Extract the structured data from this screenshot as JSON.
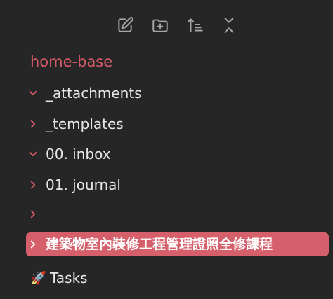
{
  "toolbar": {
    "buttons": [
      {
        "name": "new-note",
        "icon": "edit-icon"
      },
      {
        "name": "new-folder",
        "icon": "folder-plus-icon"
      },
      {
        "name": "sort",
        "icon": "sort-icon"
      },
      {
        "name": "collapse-all",
        "icon": "collapse-icon"
      }
    ]
  },
  "vault": {
    "title": "home-base"
  },
  "tree": {
    "items": [
      {
        "label": "_attachments",
        "expanded": true
      },
      {
        "label": "_templates",
        "expanded": false
      },
      {
        "label": "00. inbox",
        "expanded": true
      },
      {
        "label": "01. journal",
        "expanded": false
      },
      {
        "label": "",
        "expanded": false
      },
      {
        "label": "建築物室內裝修工程管理證照全修課程",
        "expanded": false,
        "active": true
      }
    ],
    "note": {
      "emoji": "🚀",
      "label": "Tasks"
    }
  },
  "colors": {
    "background": "#262626",
    "accent": "#d65a67",
    "active_bg": "#d55f6b",
    "text": "#e6e6e6",
    "icon": "#a6a6a6"
  }
}
